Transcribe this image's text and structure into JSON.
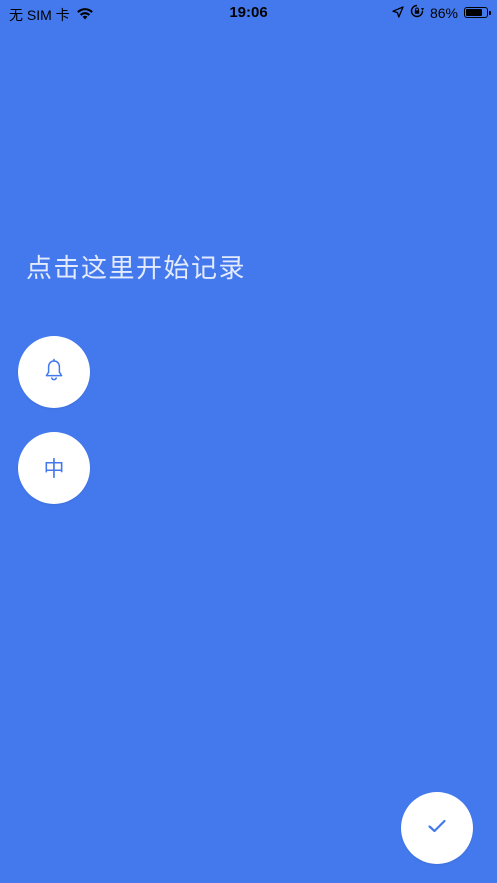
{
  "status_bar": {
    "carrier": "无 SIM 卡",
    "time": "19:06",
    "battery_percent": "86%",
    "battery_level": 0.86
  },
  "main": {
    "prompt": "点击这里开始记录"
  },
  "priority_button": {
    "label": "中"
  },
  "icons": {
    "wifi": "wifi-icon",
    "location": "location-arrow-icon",
    "rotation_lock": "rotation-lock-icon",
    "battery": "battery-icon",
    "bell": "bell-icon",
    "confirm": "checkmark-icon"
  },
  "colors": {
    "background": "#4479ee",
    "button_bg": "#ffffff",
    "accent": "#4479ee"
  }
}
